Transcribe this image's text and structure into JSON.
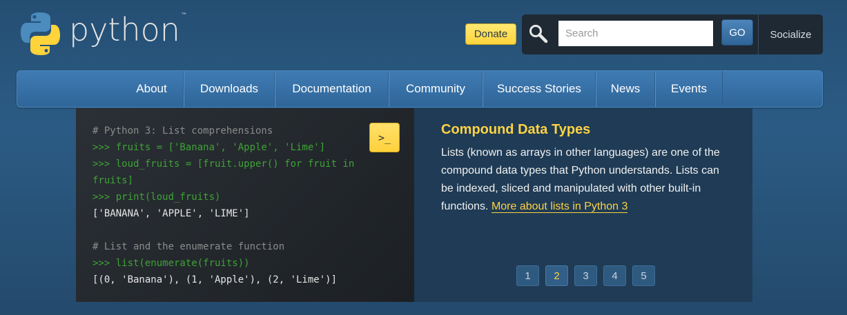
{
  "brand": {
    "name": "python",
    "tm": "™"
  },
  "header": {
    "donate_label": "Donate",
    "search_placeholder": "Search",
    "go_label": "GO",
    "socialize_label": "Socialize"
  },
  "nav": [
    {
      "label": "About"
    },
    {
      "label": "Downloads"
    },
    {
      "label": "Documentation"
    },
    {
      "label": "Community"
    },
    {
      "label": "Success Stories"
    },
    {
      "label": "News"
    },
    {
      "label": "Events"
    }
  ],
  "code": {
    "shell_button_label": ">_",
    "lines": [
      {
        "kind": "comment",
        "text": "# Python 3: List comprehensions"
      },
      {
        "kind": "prompt",
        "text": ">>> fruits = ['Banana', 'Apple', 'Lime']"
      },
      {
        "kind": "prompt",
        "text": ">>> loud_fruits = [fruit.upper() for fruit in"
      },
      {
        "kind": "prompt",
        "text": "fruits]"
      },
      {
        "kind": "prompt",
        "text": ">>> print(loud_fruits)"
      },
      {
        "kind": "out",
        "text": "['BANANA', 'APPLE', 'LIME']"
      },
      {
        "kind": "blank",
        "text": ""
      },
      {
        "kind": "comment",
        "text": "# List and the enumerate function"
      },
      {
        "kind": "prompt",
        "text": ">>> list(enumerate(fruits))"
      },
      {
        "kind": "out",
        "text": "[(0, 'Banana'), (1, 'Apple'), (2, 'Lime')]"
      }
    ]
  },
  "feature": {
    "title": "Compound Data Types",
    "body": "Lists (known as arrays in other languages) are one of the compound data types that Python understands. Lists can be indexed, sliced and manipulated with other built-in functions. ",
    "link_label": "More about lists in Python 3"
  },
  "pager": {
    "pages": [
      "1",
      "2",
      "3",
      "4",
      "5"
    ],
    "active": "2"
  },
  "colors": {
    "accent_yellow": "#ffd343",
    "nav_blue": "#3f7bb3",
    "code_green": "#3ea335"
  }
}
